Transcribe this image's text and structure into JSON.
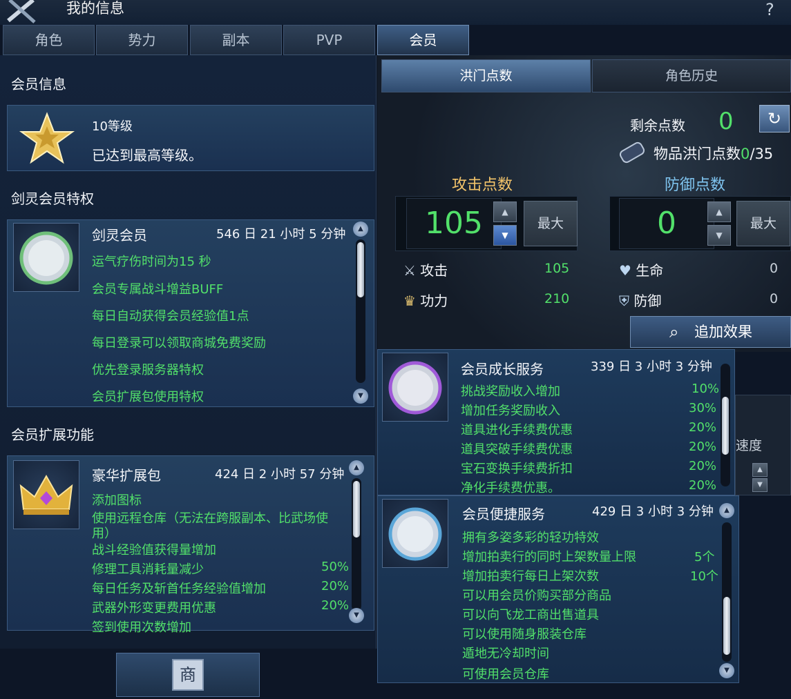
{
  "window": {
    "title": "我的信息",
    "help": "?"
  },
  "tabs": [
    "角色",
    "势力",
    "副本",
    "PVP",
    "会员"
  ],
  "left": {
    "member_info_title": "会员信息",
    "level_label": "10等级",
    "level_desc": "已达到最高等级。",
    "privilege_title": "剑灵会员特权",
    "privilege": {
      "name": "剑灵会员",
      "time": "546 日 21 小时 5 分钟",
      "icon_text": "剑灵会员",
      "lines": [
        "运气疗伤时间为15 秒",
        "会员专属战斗增益BUFF",
        "每日自动获得会员经验值1点",
        "每日登录可以领取商城免费奖励",
        "优先登录服务器特权",
        "会员扩展包使用特权"
      ]
    },
    "extension_title": "会员扩展功能",
    "extension": {
      "name": "豪华扩展包",
      "time": "424 日 2 小时 57 分钟",
      "lines": [
        {
          "text": "添加图标",
          "value": ""
        },
        {
          "text": "使用远程仓库（无法在跨服副本、比武场使",
          "value": ""
        },
        {
          "text": "用）",
          "value": ""
        },
        {
          "text": "战斗经验值获得量增加",
          "value": ""
        },
        {
          "text": "修理工具消耗量减少",
          "value": "50%"
        },
        {
          "text": "每日任务及斩首任务经验值增加",
          "value": "20%"
        },
        {
          "text": "武器外形变更费用优惠",
          "value": "20%"
        },
        {
          "text": "签到使用次数增加",
          "value": ""
        }
      ]
    }
  },
  "right": {
    "tabs": [
      "洪门点数",
      "角色历史"
    ],
    "remaining_label": "剩余点数",
    "remaining_value": "0",
    "item_points_label": "物品洪门点数",
    "item_points_value": "0",
    "item_points_max": "/35",
    "attack_title": "攻击点数",
    "defense_title": "防御点数",
    "attack_value": "105",
    "defense_value": "0",
    "max_label": "最大",
    "stats_left": [
      {
        "label": "攻击",
        "value": "105"
      },
      {
        "label": "功力",
        "value": "210"
      }
    ],
    "stats_right": [
      {
        "label": "生命",
        "value": "0"
      },
      {
        "label": "防御",
        "value": "0"
      }
    ],
    "add_effect_label": "追加效果",
    "bg_fragment": "速度",
    "growth": {
      "name": "会员成长服务",
      "time": "339 日 3 小时 3 分钟",
      "icon_text": "成长服务",
      "lines": [
        {
          "text": "挑战奖励收入增加",
          "value": "10%"
        },
        {
          "text": "增加任务奖励收入",
          "value": "30%"
        },
        {
          "text": "道具进化手续费优惠",
          "value": "20%"
        },
        {
          "text": "道具突破手续费优惠",
          "value": "20%"
        },
        {
          "text": "宝石变换手续费折扣",
          "value": "20%"
        },
        {
          "text": "净化手续费优惠。",
          "value": "20%"
        }
      ]
    },
    "convenience": {
      "name": "会员便捷服务",
      "time": "429 日 3 小时 3 分钟",
      "icon_text": "便捷服务",
      "lines": [
        {
          "text": "拥有多姿多彩的轻功特效",
          "value": ""
        },
        {
          "text": "增加拍卖行的同时上架数量上限",
          "value": "5个"
        },
        {
          "text": "增加拍卖行每日上架次数",
          "value": "10个"
        },
        {
          "text": "可以用会员价购买部分商品",
          "value": ""
        },
        {
          "text": "可以向飞龙工商出售道具",
          "value": ""
        },
        {
          "text": "可以使用随身服装仓库",
          "value": ""
        },
        {
          "text": "遁地无冷却时间",
          "value": ""
        },
        {
          "text": "可使用会员仓库",
          "value": ""
        }
      ]
    }
  },
  "bottom": {
    "shop_icon_char": "商"
  }
}
